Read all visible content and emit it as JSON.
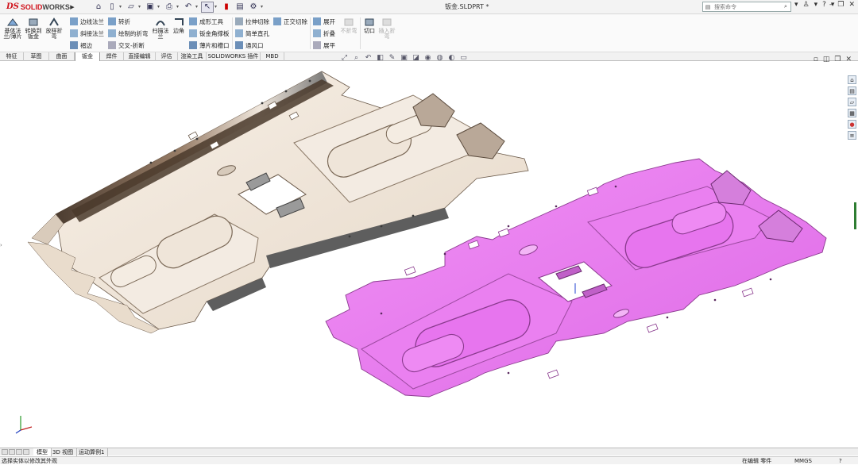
{
  "app": {
    "logo_prefix": "DS",
    "logo_name": "SOLID",
    "logo_name2": "WORKS",
    "document_title": "钣金.SLDPRT *"
  },
  "search": {
    "placeholder": "搜索命令"
  },
  "ribbon": {
    "large_buttons": [
      {
        "label": "基体法兰/薄片"
      },
      {
        "label": "转换到钣金"
      },
      {
        "label": "放样折弯"
      },
      {
        "label": "扫描法兰"
      },
      {
        "label": "边角"
      },
      {
        "label": "不折弯"
      },
      {
        "label": "切口"
      },
      {
        "label": "插入折弯"
      }
    ],
    "small_buttons": [
      {
        "label": "边线法兰"
      },
      {
        "label": "斜接法兰"
      },
      {
        "label": "褶边"
      },
      {
        "label": "转折"
      },
      {
        "label": "绘制的折弯"
      },
      {
        "label": "交叉-折断"
      },
      {
        "label": "成形工具"
      },
      {
        "label": "钣金角撑板"
      },
      {
        "label": "薄片和槽口"
      },
      {
        "label": "拉伸切除"
      },
      {
        "label": "简单直孔"
      },
      {
        "label": "通风口"
      },
      {
        "label": "正交切除"
      },
      {
        "label": "展开"
      },
      {
        "label": "折叠"
      },
      {
        "label": "展平"
      }
    ]
  },
  "command_tabs": [
    {
      "label": "特征"
    },
    {
      "label": "草图"
    },
    {
      "label": "曲面"
    },
    {
      "label": "钣金",
      "active": true
    },
    {
      "label": "焊件"
    },
    {
      "label": "直接编辑"
    },
    {
      "label": "评估"
    },
    {
      "label": "渲染工具"
    },
    {
      "label": "SOLIDWORKS 插件"
    },
    {
      "label": "MBD"
    }
  ],
  "model_tabs": [
    {
      "label": "模型",
      "active": true
    },
    {
      "label": "3D 视图"
    },
    {
      "label": "运动算例1"
    }
  ],
  "status": {
    "message": "选择实体以修改其外观",
    "mode": "在编辑 零件",
    "units": "MMGS"
  },
  "colors": {
    "part_left": "#efe4d6",
    "part_right": "#e67af0",
    "brand_red": "#d0121b"
  }
}
